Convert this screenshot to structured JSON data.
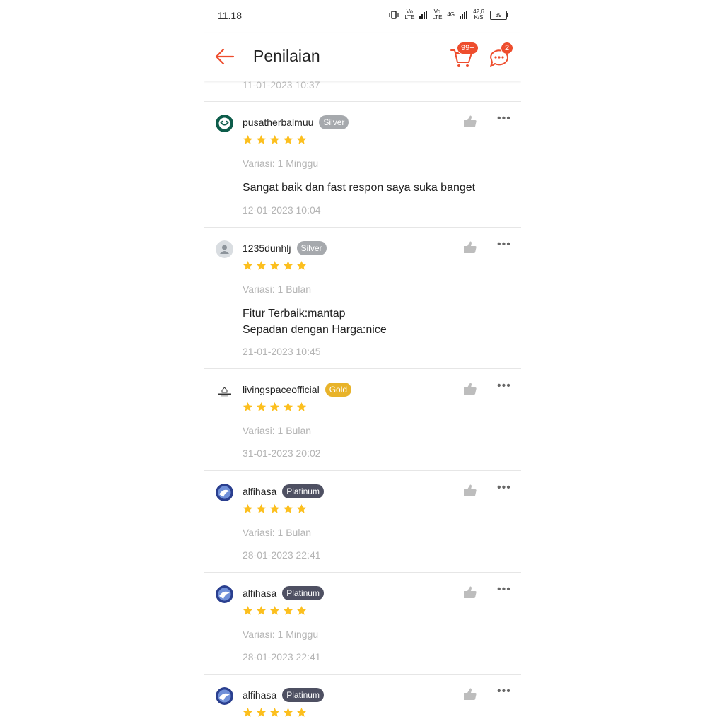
{
  "status_bar": {
    "time": "11.18",
    "net_volte1": "Vo LTE",
    "net_volte2": "Vo LTE",
    "net_4g": "4G",
    "speed": "42,6 K/S",
    "battery": "39"
  },
  "header": {
    "title": "Penilaian",
    "cart_badge": "99+",
    "chat_badge": "2",
    "accent": "#ee4d2d"
  },
  "previous_date": "11-01-2023 10:37",
  "reviews": [
    {
      "username": "pusatherbalmuu",
      "tier": "Silver",
      "rating": 5,
      "variasi": "Variasi: 1 Minggu",
      "comment_lines": [
        "Sangat baik dan fast respon saya suka banget"
      ],
      "date": "12-01-2023 10:04"
    },
    {
      "username": "1235dunhlj",
      "tier": "Silver",
      "rating": 5,
      "variasi": "Variasi: 1 Bulan",
      "comment_lines": [
        "Fitur Terbaik:mantap",
        "Sepadan dengan Harga:nice"
      ],
      "date": "21-01-2023 10:45"
    },
    {
      "username": "livingspaceofficial",
      "tier": "Gold",
      "rating": 5,
      "variasi": "Variasi: 1 Bulan",
      "comment_lines": [],
      "date": "31-01-2023 20:02"
    },
    {
      "username": "alfihasa",
      "tier": "Platinum",
      "rating": 5,
      "variasi": "Variasi: 1 Bulan",
      "comment_lines": [],
      "date": "28-01-2023 22:41"
    },
    {
      "username": "alfihasa",
      "tier": "Platinum",
      "rating": 5,
      "variasi": "Variasi: 1 Minggu",
      "comment_lines": [],
      "date": "28-01-2023 22:41"
    },
    {
      "username": "alfihasa",
      "tier": "Platinum",
      "rating": 5,
      "variasi": "",
      "comment_lines": [],
      "date": ""
    }
  ],
  "colors": {
    "star": "#fcbf1e",
    "silver": "#a6a9ad",
    "gold": "#e8b32a",
    "platinum": "#4e5062"
  }
}
